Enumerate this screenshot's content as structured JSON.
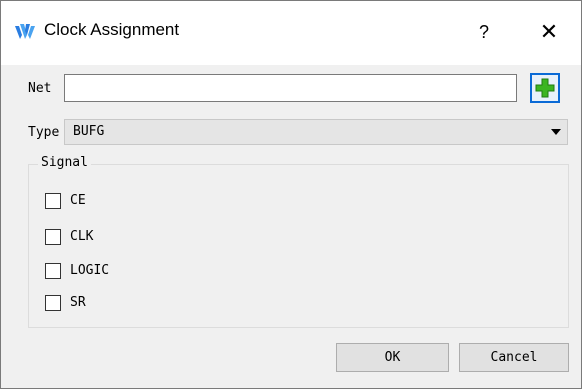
{
  "window": {
    "title": "Clock Assignment",
    "help_label": "?",
    "close_label": "✕"
  },
  "net": {
    "label": "Net",
    "value": "",
    "add_icon": "green-plus-icon"
  },
  "type": {
    "label": "Type",
    "selected": "BUFG"
  },
  "signal": {
    "legend": "Signal",
    "options": [
      {
        "label": "CE",
        "checked": false
      },
      {
        "label": "CLK",
        "checked": false
      },
      {
        "label": "LOGIC",
        "checked": false
      },
      {
        "label": "SR",
        "checked": false
      }
    ]
  },
  "buttons": {
    "ok": "OK",
    "cancel": "Cancel"
  },
  "colors": {
    "accent": "#0a6ad6",
    "plus_green": "#3cb521"
  }
}
